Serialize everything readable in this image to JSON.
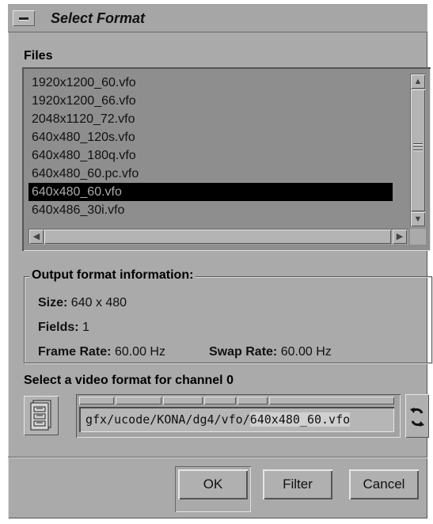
{
  "window": {
    "title": "Select Format"
  },
  "files": {
    "label": "Files",
    "items": [
      "1920x1200_60.vfo",
      "1920x1200_66.vfo",
      "2048x1120_72.vfo",
      "640x480_120s.vfo",
      "640x480_180q.vfo",
      "640x480_60.pc.vfo",
      "640x480_60.vfo",
      "640x486_30i.vfo"
    ],
    "selected_index": 6
  },
  "output_info": {
    "title": "Output format information:",
    "size_label": "Size:",
    "size_value": "640 x 480",
    "fields_label": "Fields:",
    "fields_value": "1",
    "frame_rate_label": "Frame Rate:",
    "frame_rate_value": "60.00 Hz",
    "swap_rate_label": "Swap Rate:",
    "swap_rate_value": "60.00 Hz"
  },
  "channel": {
    "label": "Select a video format for channel 0",
    "path_prefix": "gfx/ucode/KONA/dg4/vfo/",
    "path_file": "640x480_60.vfo"
  },
  "buttons": {
    "ok": "OK",
    "filter": "Filter",
    "cancel": "Cancel"
  },
  "icons": {
    "window_menu": "window-menu-icon",
    "file_browser": "file-cabinet-icon",
    "cycle": "cycle-arrows-icon",
    "scroll_up": "arrow-up-icon",
    "scroll_down": "arrow-down-icon",
    "scroll_left": "arrow-left-icon",
    "scroll_right": "arrow-right-icon"
  }
}
